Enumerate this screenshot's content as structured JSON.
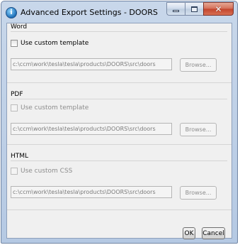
{
  "window": {
    "title": "Advanced Export Settings - DOORS",
    "icon": "info-app-icon"
  },
  "sections": {
    "word": {
      "label": "Word",
      "checkbox_label": "Use custom template",
      "checked": false,
      "enabled": true,
      "path": "c:\\ccm\\work\\tesla\\tesla\\products\\DOORS\\src\\doors",
      "browse_label": "Browse..."
    },
    "pdf": {
      "label": "PDF",
      "checkbox_label": "Use custom template",
      "checked": false,
      "enabled": false,
      "path": "c:\\ccm\\work\\tesla\\tesla\\products\\DOORS\\src\\doors",
      "browse_label": "Browse..."
    },
    "html": {
      "label": "HTML",
      "checkbox_label": "Use custom CSS",
      "checked": false,
      "enabled": false,
      "path": "c:\\ccm\\work\\tesla\\tesla\\products\\DOORS\\src\\doors",
      "browse_label": "Browse..."
    }
  },
  "footer": {
    "ok_label": "OK",
    "cancel_label": "Cancel"
  }
}
